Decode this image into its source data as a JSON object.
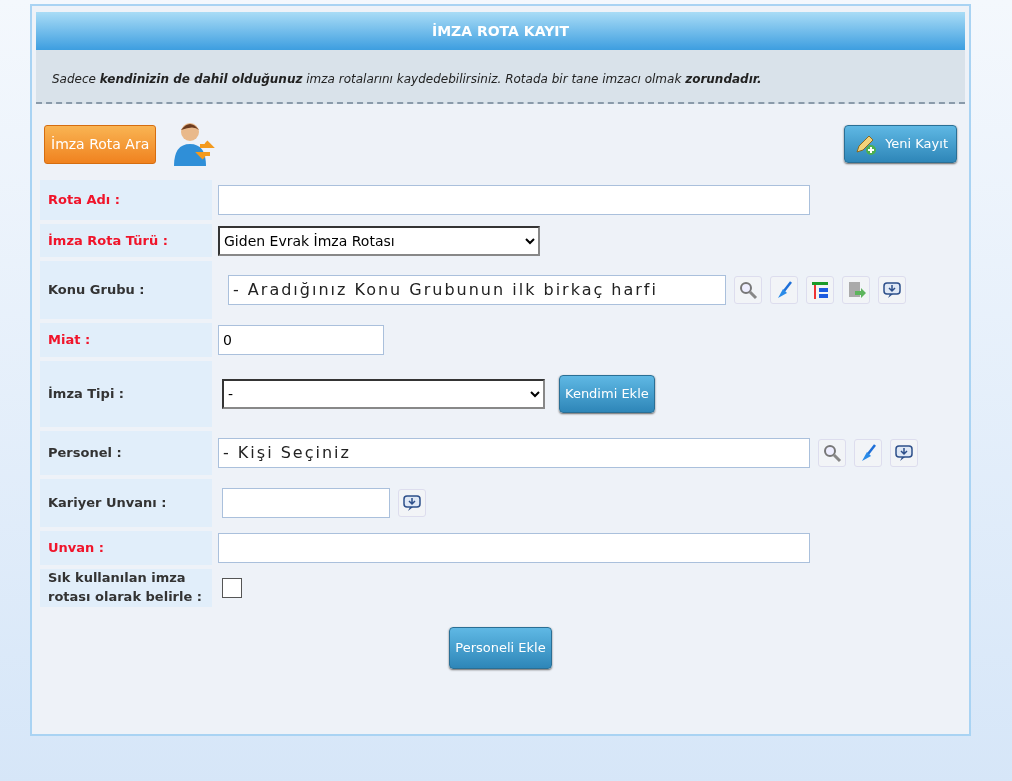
{
  "panel": {
    "title": "İMZA ROTA KAYIT",
    "notice": "Sadece **kendinizin de dahil olduğunuz** imza rotalarını kaydedebilirsiniz. Rotada bir tane imzacı olmak **zorundadır.**"
  },
  "toolbar": {
    "search_button": "İmza Rota Ara",
    "new_button": "Yeni Kayıt"
  },
  "fields": [
    {
      "label": "Rota Adı :",
      "required": true,
      "kind": "text"
    },
    {
      "label": "İmza Rota Türü :",
      "required": true,
      "kind": "select",
      "value": "Giden Evrak İmza Rotası"
    },
    {
      "label": "Konu Grubu :",
      "required": false,
      "kind": "lookup",
      "placeholder": "- Aradığınız Konu Grubunun ilk birkaç harfi",
      "tools": [
        {
          "kind": "search"
        },
        {
          "kind": "clear"
        },
        {
          "kind": "tree"
        },
        {
          "kind": "transfer"
        },
        {
          "kind": "comment"
        }
      ]
    },
    {
      "label": "Miat :",
      "required": true,
      "kind": "text",
      "value": "0"
    },
    {
      "label": "İmza Tipi :",
      "required": false,
      "kind": "select",
      "value": "-",
      "button": "Kendimi Ekle"
    },
    {
      "label": "Personel :",
      "required": false,
      "kind": "lookup",
      "placeholder": "- Kişi Seçiniz",
      "tools": [
        {
          "kind": "search"
        },
        {
          "kind": "clear"
        },
        {
          "kind": "comment"
        }
      ]
    },
    {
      "label": "Kariyer Unvanı :",
      "required": false,
      "kind": "text",
      "tools": [
        {
          "kind": "comment"
        }
      ]
    },
    {
      "label": "Unvan :",
      "required": true,
      "kind": "text"
    },
    {
      "label": "Sık kullanılan imza rotası olarak belirle :",
      "required": false,
      "kind": "checkbox",
      "checked": false
    }
  ],
  "submit_button": "Personeli Ekle"
}
